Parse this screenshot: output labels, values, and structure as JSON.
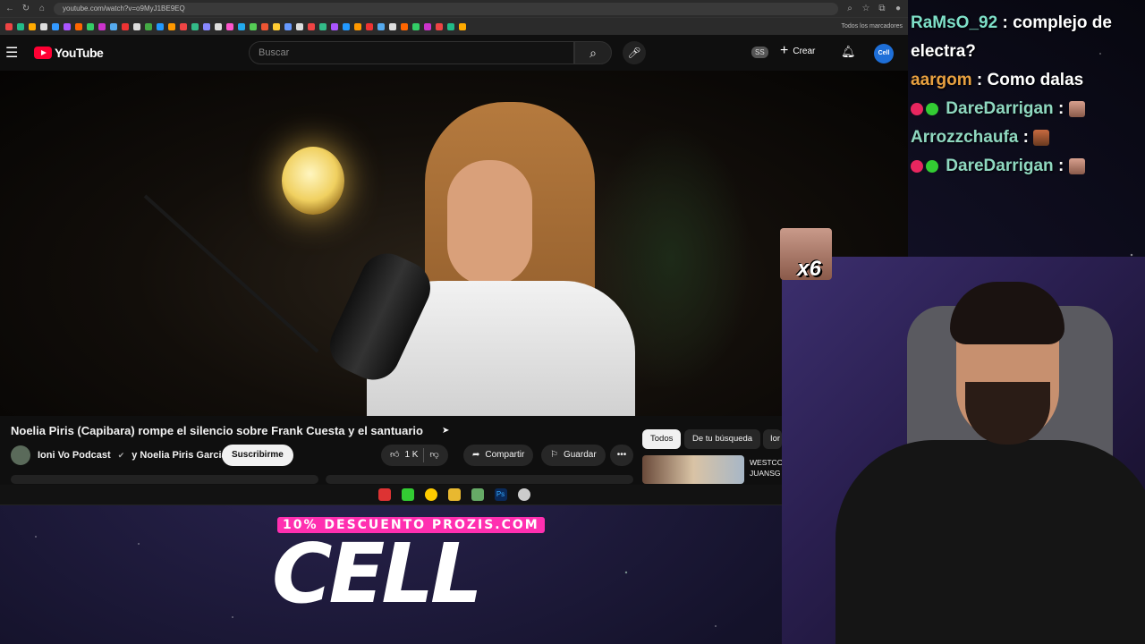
{
  "browser": {
    "url": "youtube.com/watch?v=o9MyJ1BE9EQ",
    "bookmarks_folder": "Todos los marcadores"
  },
  "youtube": {
    "logo": "YouTube",
    "search_placeholder": "Buscar",
    "ss_badge": "SS",
    "create_label": "Crear",
    "avatar_text": "Cell"
  },
  "video": {
    "title": "Noelia Piris (Capibara) rompe el silencio sobre Frank Cuesta y el santuario",
    "channel": "Ioni Vo Podcast",
    "channel_joiner": "y Noelia Piris Garcia",
    "subscribe_label": "Suscribirme",
    "likes": "1 K",
    "share_label": "Compartir",
    "save_label": "Guardar"
  },
  "sidebar": {
    "chips": [
      "Todos",
      "De tu búsqueda",
      "Ior"
    ],
    "rec_title": "WESTCO JUANSG"
  },
  "chat": [
    {
      "user": "RaMsO_92",
      "text": "complejo de electra?",
      "user_color": "#7ee0c8"
    },
    {
      "user": "aargom",
      "text": "Como dalas",
      "user_color": "#e8a040"
    },
    {
      "user": "DareDarrigan",
      "text": "",
      "user_color": "#8fd8c0"
    },
    {
      "user": "Arrozzchaufa",
      "text": "",
      "user_color": "#8fd8c0"
    },
    {
      "user": "DareDarrigan",
      "text": "",
      "user_color": "#8fd8c0"
    }
  ],
  "overlay": {
    "emote_count": "x6"
  },
  "sponsor": {
    "promo": "10% DESCUENTO PROZIS.COM",
    "brand": "CELL"
  }
}
